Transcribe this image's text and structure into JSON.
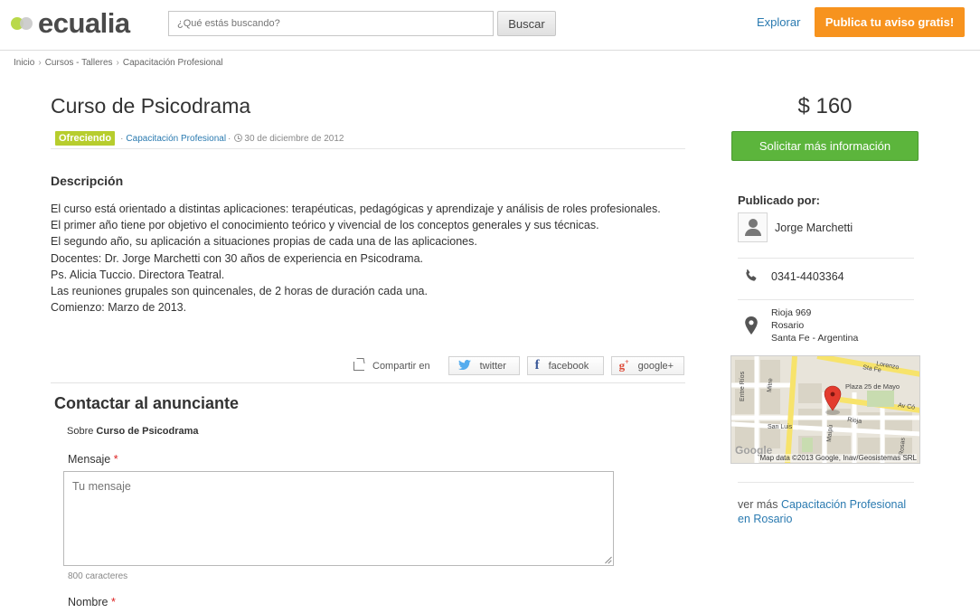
{
  "header": {
    "logo_text": "ecualia",
    "search_placeholder": "¿Qué estás buscando?",
    "search_button": "Buscar",
    "explorar": "Explorar",
    "publica": "Publica tu aviso gratis!"
  },
  "breadcrumb": {
    "items": [
      "Inicio",
      "Cursos - Talleres",
      "Capacitación Profesional"
    ],
    "separator": "›"
  },
  "listing": {
    "title": "Curso de Psicodrama",
    "badge": "Ofreciendo",
    "category_prefix": "·",
    "category": "Capacitación Profesional",
    "date_sep": "·",
    "date": "30 de diciembre de 2012",
    "price": "$ 160",
    "description_title": "Descripción",
    "description_lines": [
      "El curso está orientado a distintas aplicaciones: terapéuticas, pedagógicas y aprendizaje y análisis de roles profesionales.",
      "El primer año tiene por objetivo el conocimiento teórico y vivencial de los conceptos generales y sus técnicas.",
      "El segundo año, su aplicación a situaciones propias de cada una de las aplicaciones.",
      "Docentes: Dr. Jorge Marchetti con 30 años de experiencia en Psicodrama.",
      "Ps. Alicia Tuccio. Directora Teatral.",
      "Las reuniones grupales son quincenales, de 2 horas de duración cada una.",
      "Comienzo: Marzo de 2013."
    ]
  },
  "share": {
    "label": "Compartir en",
    "twitter": "twitter",
    "facebook": "facebook",
    "google": "google+"
  },
  "contact": {
    "title": "Contactar al anunciante",
    "sobre_prefix": "Sobre",
    "sobre_title": "Curso de Psicodrama",
    "mensaje_label": "Mensaje",
    "required_mark": "*",
    "mensaje_placeholder": "Tu mensaje",
    "char_count": "800 caracteres",
    "nombre_label": "Nombre"
  },
  "sidebar": {
    "solicitar": "Solicitar más información",
    "publicado_por": "Publicado por:",
    "author": "Jorge Marchetti",
    "phone": "0341-4403364",
    "address": [
      "Rioja 969",
      "Rosario",
      "Santa Fe - Argentina"
    ],
    "map_caption": "Map data ©2013 Google, Inav/Geosistemas SRL",
    "map_logo": "Google",
    "map_labels": [
      "Sta Fe",
      "Lorenzo",
      "Entre Ríos",
      "Mitre",
      "Plaza 25 de Mayo",
      "Av Có",
      "Rioja",
      "San Luis",
      "Maipú",
      "Rosas"
    ],
    "ver_mas_prefix": "ver más",
    "ver_mas_link": "Capacitación Profesional en Rosario"
  },
  "colors": {
    "accent_orange": "#f7931e",
    "accent_green": "#5cb53c",
    "badge_green": "#b7cd2d",
    "link_blue": "#2a7ab0"
  }
}
